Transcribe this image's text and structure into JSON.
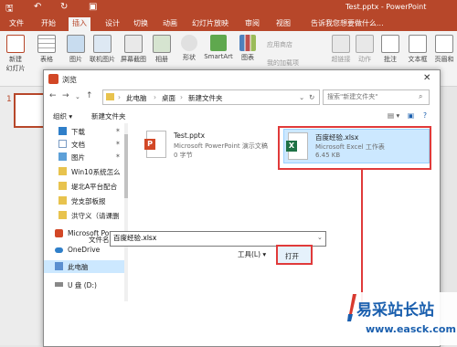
{
  "app": {
    "doc_title": "Test.pptx - PowerPoint",
    "tabs": [
      "文件",
      "开始",
      "插入",
      "设计",
      "切换",
      "动画",
      "幻灯片放映",
      "审阅",
      "视图"
    ],
    "active_tab": "插入",
    "tell_me": "告诉我您想要做什么..."
  },
  "ribbon": {
    "new_slide": "新建\n幻灯片",
    "table": "表格",
    "picture": "图片",
    "online_picture": "联机图片",
    "screenshot": "屏幕截图",
    "album": "相册",
    "shapes": "形状",
    "smartart": "SmartArt",
    "chart": "图表",
    "store": "应用商店",
    "my_addins": "我的加载项",
    "hyperlink": "超链接",
    "action": "动作",
    "comment": "批注",
    "textbox": "文本框",
    "header_footer": "页眉和"
  },
  "slide_panel": {
    "number": "1"
  },
  "dialog": {
    "title": "浏览",
    "breadcrumbs": [
      "此电脑",
      "桌面",
      "新建文件夹"
    ],
    "search_placeholder": "搜索\"新建文件夹\"",
    "organize": "组织 ▾",
    "new_folder": "新建文件夹",
    "nav_items": [
      {
        "label": "下载",
        "icon": "download-icon",
        "pinned": true
      },
      {
        "label": "文档",
        "icon": "document-icon",
        "pinned": true
      },
      {
        "label": "图片",
        "icon": "picture-icon",
        "pinned": true
      },
      {
        "label": "Win10系统怎么",
        "icon": "folder-icon",
        "pinned": false
      },
      {
        "label": "堤北A平台配合",
        "icon": "folder-icon",
        "pinned": false
      },
      {
        "label": "党支部板报",
        "icon": "folder-icon",
        "pinned": false
      },
      {
        "label": "洪守义（请课删",
        "icon": "folder-icon",
        "pinned": false
      },
      {
        "label": "Microsoft Powe",
        "icon": "powerpoint-icon",
        "pinned": false
      },
      {
        "label": "OneDrive",
        "icon": "cloud-icon",
        "pinned": false
      },
      {
        "label": "此电脑",
        "icon": "computer-icon",
        "pinned": false
      },
      {
        "label": "U 盘 (D:)",
        "icon": "drive-icon",
        "pinned": false
      }
    ],
    "files": [
      {
        "name": "Test.pptx",
        "type": "Microsoft PowerPoint 演示文稿",
        "size": "0 字节"
      },
      {
        "name": "百度经验.xlsx",
        "type": "Microsoft Excel 工作表",
        "size": "6.45 KB"
      }
    ],
    "filename_label": "文件名(N):",
    "filename_value": "百度经验.xlsx",
    "tools": "工具(L)",
    "open": "打开"
  },
  "watermark": {
    "title": "易采站长站",
    "url": "www.easck.com"
  },
  "colors": {
    "accent": "#b7472a",
    "highlight": "#e03a3a",
    "selected": "#cce8ff",
    "excel": "#1e7145"
  }
}
